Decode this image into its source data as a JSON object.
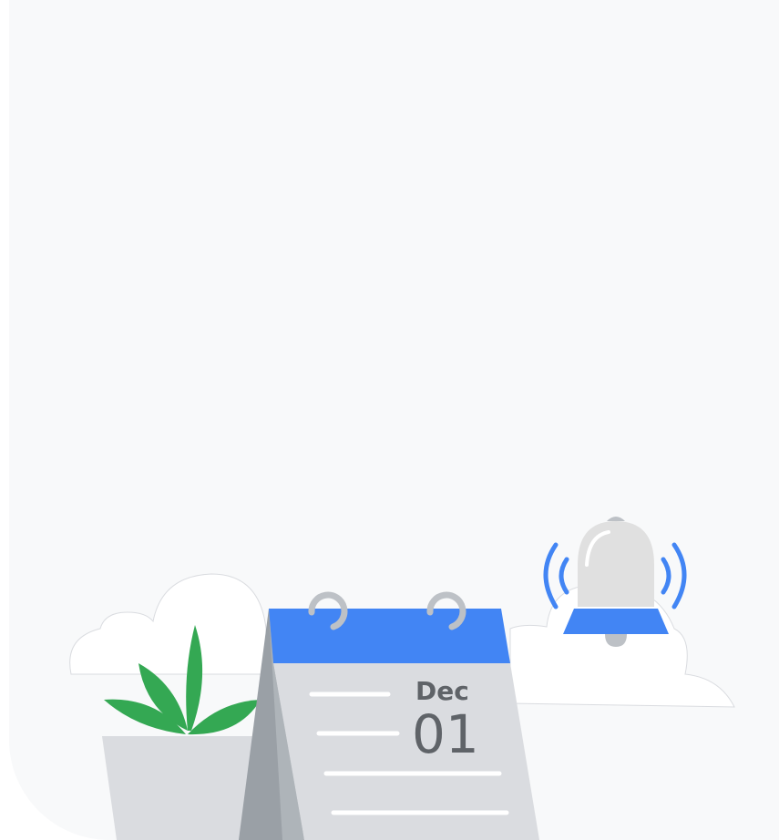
{
  "calendar": {
    "month": "Dec",
    "day": "01"
  },
  "colors": {
    "background": "#f8f9fa",
    "calendar_header": "#4285f4",
    "calendar_page": "#dadce0",
    "leaf_green": "#34a853",
    "bell_body": "#e0e0e0",
    "bell_base": "#4285f4",
    "sound_waves": "#4285f4",
    "ring_grey": "#bdc1c6",
    "text_grey": "#5f6368"
  },
  "icons": [
    "cloud-icon",
    "plant-icon",
    "calendar-icon",
    "bell-icon"
  ]
}
